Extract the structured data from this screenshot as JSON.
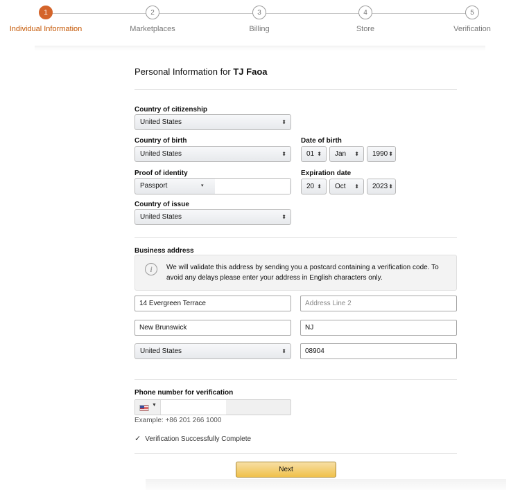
{
  "stepper": {
    "steps": [
      {
        "number": "1",
        "label": "Individual Information"
      },
      {
        "number": "2",
        "label": "Marketplaces"
      },
      {
        "number": "3",
        "label": "Billing"
      },
      {
        "number": "4",
        "label": "Store"
      },
      {
        "number": "5",
        "label": "Verification"
      }
    ],
    "active_color": "#d4642a"
  },
  "header": {
    "title_prefix": "Personal Information for ",
    "name": "TJ Faoa"
  },
  "citizenship": {
    "label": "Country of citizenship",
    "value": "United States"
  },
  "birth_country": {
    "label": "Country of birth",
    "value": "United States"
  },
  "dob": {
    "label": "Date of birth",
    "day": "01",
    "month": "Jan",
    "year": "1990"
  },
  "identity": {
    "label": "Proof of identity",
    "value": "Passport"
  },
  "expiration": {
    "label": "Expiration date",
    "day": "20",
    "month": "Oct",
    "year": "2023"
  },
  "issue_country": {
    "label": "Country of issue",
    "value": "United States"
  },
  "address": {
    "label": "Business address",
    "notice": "We will validate this address by sending you a postcard containing a verification code. To avoid any delays please enter your address in English characters only.",
    "line1": "14 Evergreen Terrace",
    "line2_placeholder": "Address Line 2",
    "city": "New Brunswick",
    "state": "NJ",
    "country": "United States",
    "zip": "08904"
  },
  "phone": {
    "label": "Phone number for verification",
    "example": "Example: +86 201 266 1000",
    "status": "Verification Successfully Complete"
  },
  "actions": {
    "next_label": "Next",
    "next_color": "#f0c14b"
  }
}
